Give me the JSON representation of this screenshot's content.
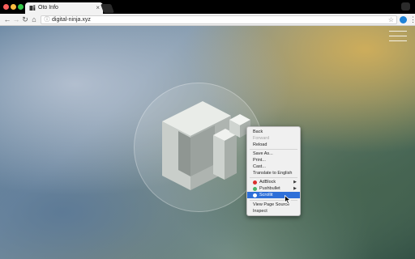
{
  "browser": {
    "tab": {
      "title": "Oto Info",
      "close_glyph": "×",
      "favicon": "oto-logo-icon"
    },
    "toolbar": {
      "back_glyph": "←",
      "forward_glyph": "→",
      "reload_glyph": "↻",
      "home_glyph": "⌂",
      "info_glyph": "ⓘ",
      "url": "digital-ninja.xyz",
      "star_glyph": "☆",
      "menu_glyph": "⋮"
    }
  },
  "page": {
    "menu_icon": "hamburger-icon",
    "logo": "oto-3d-logo"
  },
  "context_menu": {
    "items": [
      {
        "label": "Back",
        "state": "enabled"
      },
      {
        "label": "Forward",
        "state": "disabled"
      },
      {
        "label": "Reload",
        "state": "enabled"
      },
      {
        "label": "Save As...",
        "state": "enabled"
      },
      {
        "label": "Print...",
        "state": "enabled"
      },
      {
        "label": "Cast...",
        "state": "enabled"
      },
      {
        "label": "Translate to English",
        "state": "enabled"
      },
      {
        "label": "AdBlock",
        "state": "enabled",
        "submenu": "▶"
      },
      {
        "label": "Pushbullet",
        "state": "enabled",
        "submenu": "▶"
      },
      {
        "label": "Scrollit",
        "state": "selected"
      },
      {
        "label": "View Page Source",
        "state": "enabled"
      },
      {
        "label": "Inspect",
        "state": "enabled"
      }
    ]
  },
  "colors": {
    "selection": "#2d6fd8",
    "adblock": "#d9302c",
    "pushbullet": "#4ab367",
    "scrollit": "#1e82d7"
  }
}
